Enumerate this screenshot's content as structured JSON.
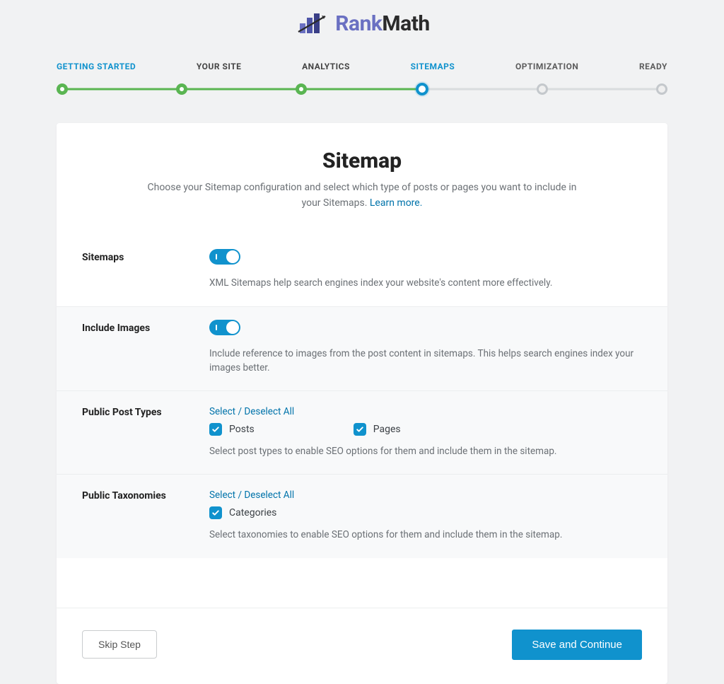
{
  "brand": {
    "rank": "Rank",
    "math": "Math"
  },
  "steps": {
    "s1": "GETTING STARTED",
    "s2": "YOUR SITE",
    "s3": "ANALYTICS",
    "s4": "SITEMAPS",
    "s5": "OPTIMIZATION",
    "s6": "READY",
    "current_index": 3,
    "fill_percent": "60%"
  },
  "page": {
    "title": "Sitemap",
    "subtitle_a": "Choose your Sitemap configuration and select which type of posts or pages you want to include in your Sitemaps. ",
    "subtitle_link": "Learn more."
  },
  "settings": {
    "sitemaps": {
      "label": "Sitemaps",
      "on": true,
      "desc": "XML Sitemaps help search engines index your website's content more effectively."
    },
    "images": {
      "label": "Include Images",
      "on": true,
      "desc": "Include reference to images from the post content in sitemaps. This helps search engines index your images better."
    },
    "post_types": {
      "label": "Public Post Types",
      "select_link": "Select / Deselect All",
      "opt1": {
        "label": "Posts",
        "checked": true
      },
      "opt2": {
        "label": "Pages",
        "checked": true
      },
      "desc": "Select post types to enable SEO options for them and include them in the sitemap."
    },
    "taxonomies": {
      "label": "Public Taxonomies",
      "select_link": "Select / Deselect All",
      "opt1": {
        "label": "Categories",
        "checked": true
      },
      "desc": "Select taxonomies to enable SEO options for them and include them in the sitemap."
    }
  },
  "footer": {
    "skip": "Skip Step",
    "save": "Save and Continue"
  }
}
